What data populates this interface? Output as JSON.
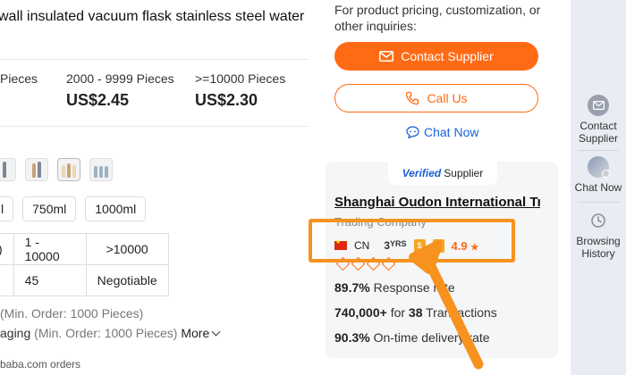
{
  "product": {
    "title": "wall insulated vacuum flask stainless steel water",
    "price_tiers": [
      {
        "range": "Pieces",
        "price": ""
      },
      {
        "range": "2000 - 9999 Pieces",
        "price": "US$2.45"
      },
      {
        "range": ">=10000 Pieces",
        "price": "US$2.30"
      }
    ],
    "sizes": [
      "l",
      "750ml",
      "1000ml"
    ],
    "lead_time_table": {
      "rows": [
        [
          "s)",
          "1 - 10000",
          ">10000"
        ],
        [
          "",
          "45",
          "Negotiable"
        ]
      ]
    },
    "customization": [
      {
        "text": "(Min. Order: 1000 Pieces)"
      },
      {
        "strong": "aging",
        "text": " (Min. Order: 1000 Pieces)",
        "more": "More"
      }
    ],
    "orders_text": "baba.com orders"
  },
  "inquiry": {
    "prompt": "For product pricing, customization, or other inquiries:",
    "contact_label": "Contact Supplier",
    "call_label": "Call Us",
    "chat_label": "Chat Now"
  },
  "supplier": {
    "verified_prefix": "Verified",
    "verified_suffix": "Supplier",
    "company": "Shanghai Oudon International Tra...",
    "type": "Trading Company",
    "country": "CN",
    "years": "3",
    "years_unit": "YRS",
    "rating": "4.9",
    "rating_star": "★",
    "response_rate": "89.7%",
    "response_label": "Response rate",
    "transactions_amount": "740,000+",
    "transactions_for": "for",
    "transactions_count": "38",
    "transactions_label": "Transactions",
    "ontime_rate": "90.3%",
    "ontime_label": "On-time delivery rate",
    "diamond_count": 4
  },
  "sidebar": {
    "items": [
      {
        "label_line1": "Contact",
        "label_line2": "Supplier",
        "icon": "mail-icon"
      },
      {
        "label_line1": "Chat Now",
        "label_line2": "",
        "icon": "avatar"
      },
      {
        "label_line1": "Browsing",
        "label_line2": "History",
        "icon": "history-icon"
      }
    ]
  },
  "colors": {
    "accent": "#ff6a14",
    "highlight": "#f7921e",
    "link": "#1a63d8",
    "sidebar_bg": "#e9ecf3"
  }
}
